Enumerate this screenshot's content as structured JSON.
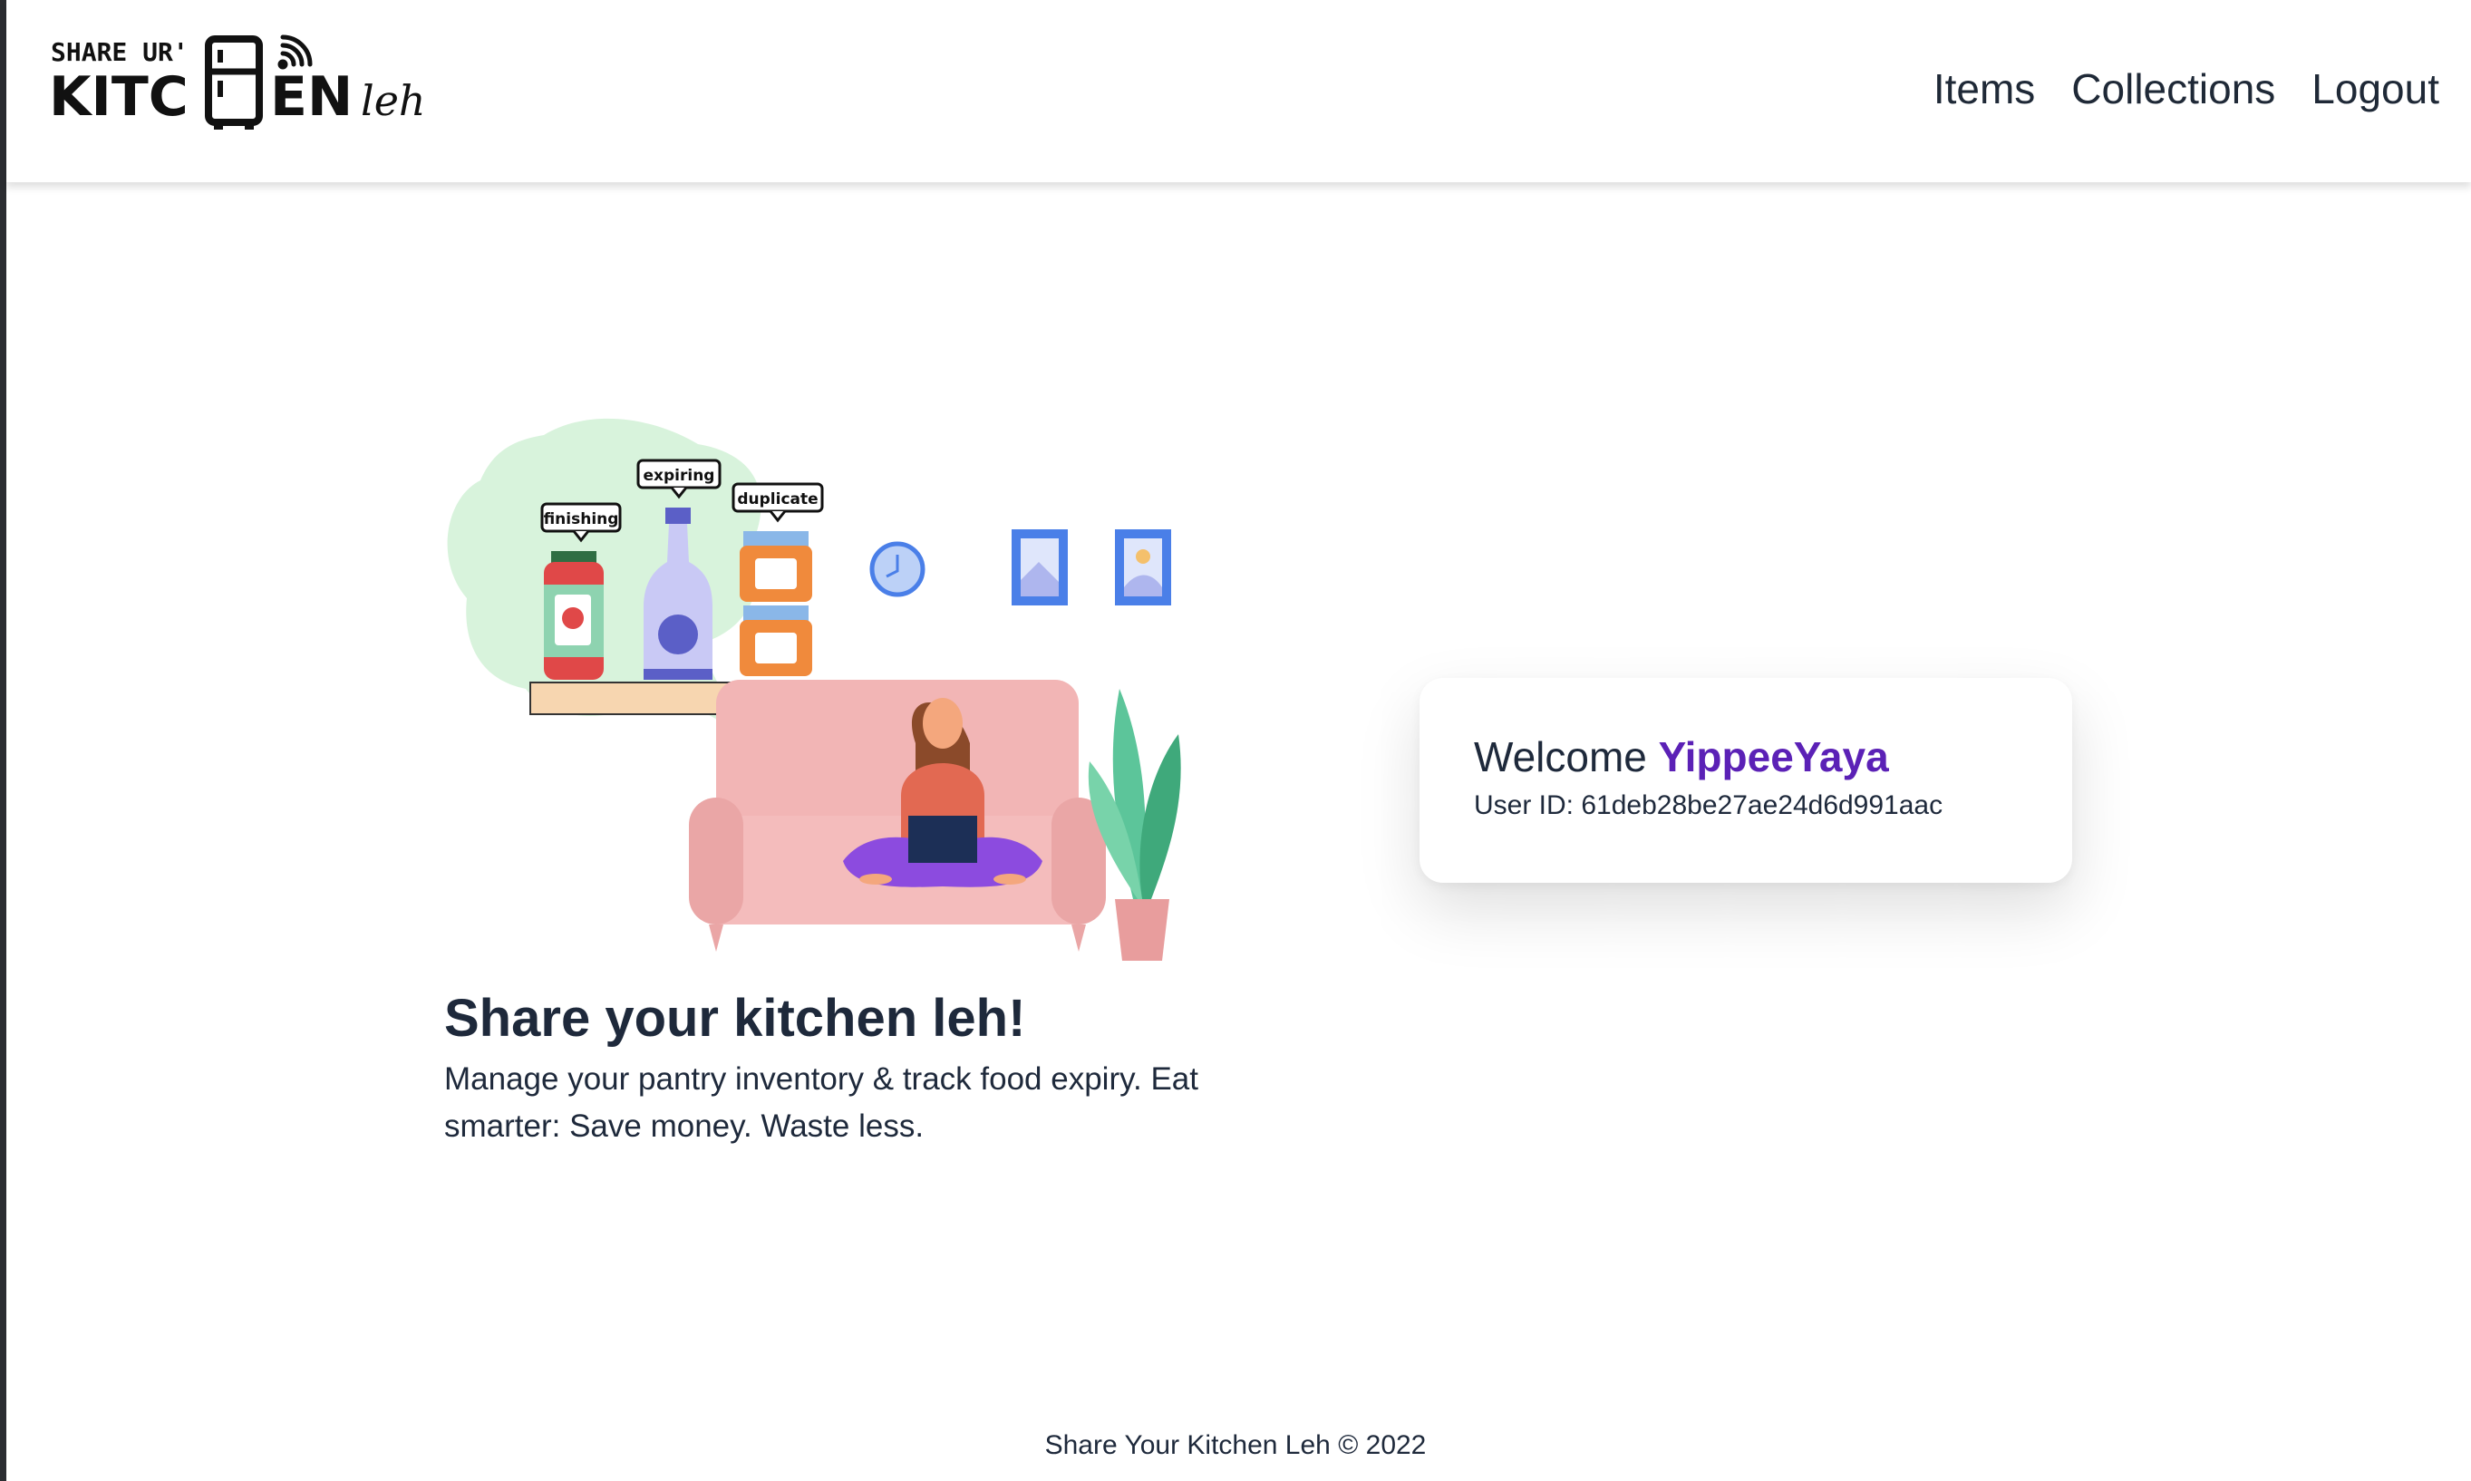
{
  "header": {
    "logo": {
      "line1": "SHARE UR'",
      "line2_left": "KITC",
      "line2_right": "EN",
      "suffix": "leh"
    },
    "nav": [
      {
        "label": "Items"
      },
      {
        "label": "Collections"
      },
      {
        "label": "Logout"
      }
    ]
  },
  "hero": {
    "title": "Share your kitchen leh!",
    "description": "Manage your pantry inventory & track food expiry. Eat smarter: Save money. Waste less.",
    "illustration_tags": [
      "finishing",
      "expiring",
      "duplicate"
    ]
  },
  "welcome_card": {
    "greeting": "Welcome",
    "username": "YippeeYaya",
    "user_id_label": "User ID:",
    "user_id": "61deb28be27ae24d6d991aac"
  },
  "footer": {
    "text": "Share Your Kitchen Leh © 2022"
  },
  "colors": {
    "accent": "#5b21b6",
    "text": "#1e293b",
    "sofa": "#f2b5b5",
    "plant": "#5cc59a",
    "frame": "#4a7fe8"
  }
}
